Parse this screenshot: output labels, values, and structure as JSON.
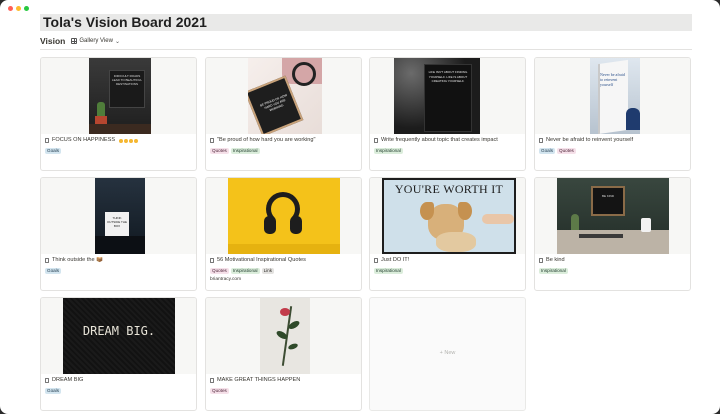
{
  "page": {
    "title": "Tola's Vision Board 2021"
  },
  "view": {
    "name": "Vision",
    "switch_label": "Gallery View"
  },
  "cards": [
    {
      "title": "FOCUS ON HAPPINESS",
      "emoji": "emoji-icons",
      "tags": [
        "Goals"
      ],
      "cover_text": "DIFFICULT ROADS LEAD TO BEAUTIFUL DESTINATIONS"
    },
    {
      "title": "\"Be proud of how hard you are working\"",
      "tags": [
        "Quotes",
        "Inspirational"
      ],
      "cover_text": "BE PROUD OF HOW HARD YOU ARE WORKING"
    },
    {
      "title": "Write frequently about topic that creates impact",
      "tags": [
        "Inspirational"
      ],
      "cover_text": "LIFE ISN'T ABOUT FINDING YOURSELF. LIFE IS ABOUT CREATING YOURSELF."
    },
    {
      "title": "Never be afraid to reinvent yourself",
      "tags": [
        "Goals",
        "Quotes"
      ],
      "cover_text": "Never be afraid to reinvent yourself"
    },
    {
      "title": "Think outside the 📦",
      "tags": [
        "Goals"
      ],
      "cover_text": "THINK OUTSIDE THE BOX"
    },
    {
      "title": "56 Motivational Inspirational Quotes",
      "tags": [
        "Quotes",
        "Inspirational",
        "Link"
      ],
      "subtitle": "briantracy.com"
    },
    {
      "title": "Just DO IT!",
      "tags": [
        "Inspirational"
      ],
      "cover_text": "YOU'RE WORTH IT"
    },
    {
      "title": "Be kind",
      "tags": [
        "Inspirational"
      ],
      "cover_text": "BE KIND"
    },
    {
      "title": "DREAM BIG",
      "tags": [
        "Goals"
      ],
      "cover_text": "DREAM BIG."
    },
    {
      "title": "MAKE GREAT THINGS HAPPEN",
      "tags": [
        "Quotes"
      ]
    }
  ],
  "new_card": {
    "label": "+ New"
  },
  "colors": {
    "tag_goals": "#d3e5ef",
    "tag_quotes": "#f5e0e9",
    "tag_inspirational": "#dbeddb",
    "tag_link": "#e3e2e0"
  }
}
